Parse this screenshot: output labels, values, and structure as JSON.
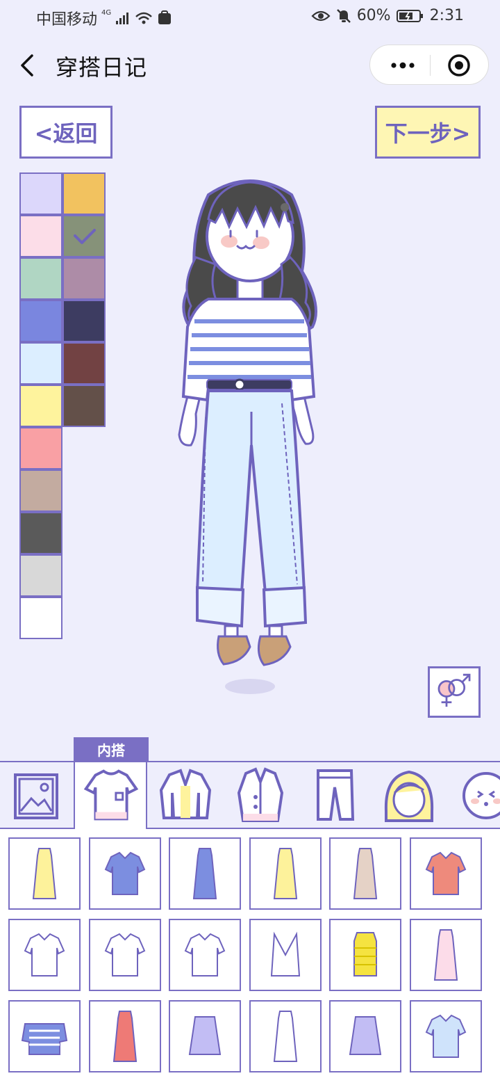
{
  "status_bar": {
    "carrier": "中国移动",
    "network": "4G",
    "battery": "60%",
    "time": "2:31"
  },
  "nav": {
    "title": "穿搭日记"
  },
  "buttons": {
    "back_label": "<返回",
    "next_label": "下一步>"
  },
  "palette": {
    "selected_index": 3,
    "colors": [
      "#dcd7fb",
      "#f2c25f",
      "#fcdde8",
      "#869279",
      "#b0d6c3",
      "#ad8ca7",
      "#7a86df",
      "#3d3c61",
      "#dceeff",
      "#724243",
      "#fef39d",
      "#635049",
      "#f9a0a4",
      "#c3aba0",
      "#5a5a5a",
      "#d8d8d8",
      "#ffffff"
    ]
  },
  "category_tabs": {
    "active_label": "内搭",
    "active_index": 1,
    "items": [
      "background-icon",
      "top-icon",
      "jacket-icon",
      "coat-icon",
      "pants-icon",
      "hair-icon",
      "face-icon"
    ]
  },
  "clothing_grid": {
    "items": [
      {
        "icon": "yellow-long-dress-icon",
        "color": "#fdf29b"
      },
      {
        "icon": "blue-polo-shirt-icon",
        "color": "#7c8ee0"
      },
      {
        "icon": "blue-button-dress-icon",
        "color": "#7c8ee0"
      },
      {
        "icon": "yellow-midi-dress-icon",
        "color": "#fdf29b"
      },
      {
        "icon": "beige-wrap-dress-icon",
        "color": "#e5d2c6"
      },
      {
        "icon": "coral-shirt-icon",
        "color": "#ee8a7c"
      },
      {
        "icon": "sailor-collar-top-icon",
        "color": "#ffffff"
      },
      {
        "icon": "plaid-tie-shirt-icon",
        "color": "#ffffff"
      },
      {
        "icon": "white-shirt-icon",
        "color": "#ffffff"
      },
      {
        "icon": "white-camisole-icon",
        "color": "#ffffff"
      },
      {
        "icon": "yellow-striped-tank-icon",
        "color": "#f5e340"
      },
      {
        "icon": "pink-shirt-dress-icon",
        "color": "#fcdce9"
      },
      {
        "icon": "striped-off-shoulder-top-icon",
        "color": "#7c8ee0"
      },
      {
        "icon": "red-long-dress-icon",
        "color": "#ee7a76"
      },
      {
        "icon": "lavender-peplum-top-icon",
        "color": "#c2bdf4"
      },
      {
        "icon": "white-bow-dress-icon",
        "color": "#ffffff"
      },
      {
        "icon": "lavender-ruffle-top-icon",
        "color": "#c2bdf4"
      },
      {
        "icon": "light-blue-shirt-icon",
        "color": "#cfe3fb"
      }
    ]
  }
}
